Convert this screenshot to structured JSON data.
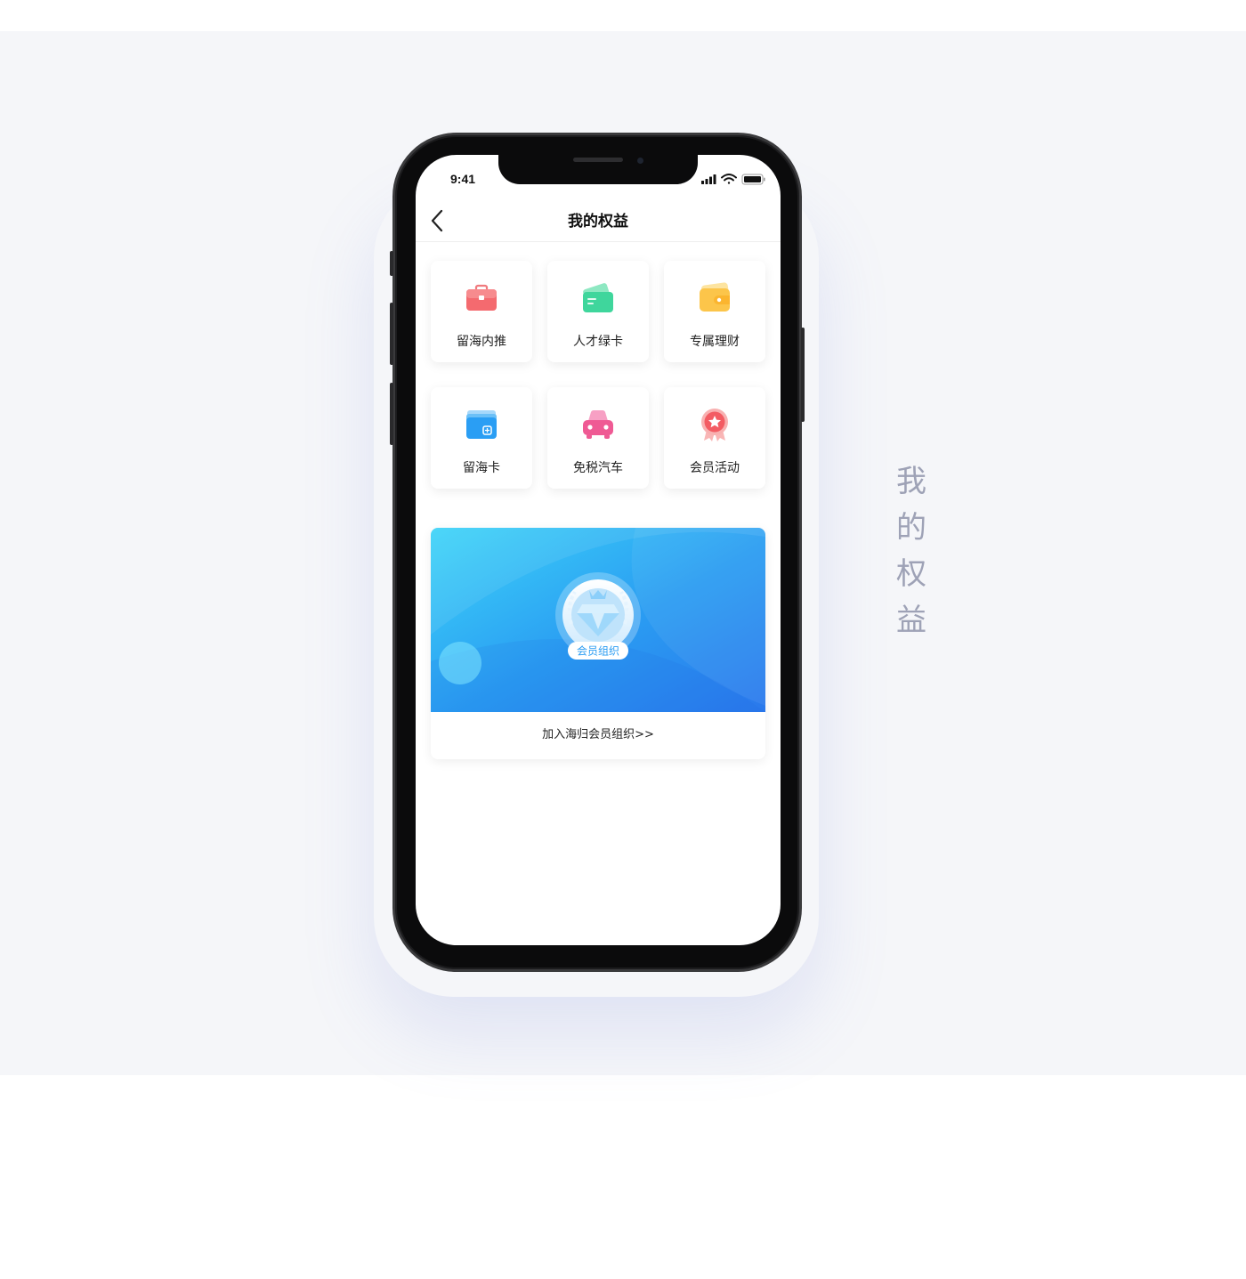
{
  "side_title": [
    "我",
    "的",
    "权",
    "益"
  ],
  "status": {
    "time": "9:41"
  },
  "nav": {
    "title": "我的权益"
  },
  "grid": [
    {
      "label": "留海内推",
      "icon": "briefcase-icon",
      "color": "#f2636a"
    },
    {
      "label": "人才绿卡",
      "icon": "card-icon",
      "color": "#39d49a"
    },
    {
      "label": "专属理财",
      "icon": "wallet-icon",
      "color": "#fcc94a"
    },
    {
      "label": "留海卡",
      "icon": "cards-icon",
      "color": "#2a9df4"
    },
    {
      "label": "免税汽车",
      "icon": "car-icon",
      "color": "#f0609a"
    },
    {
      "label": "会员活动",
      "icon": "medal-icon",
      "color": "#f46a6a"
    }
  ],
  "banner": {
    "badge": "会员组织",
    "link": "加入海归会员组织>>"
  }
}
